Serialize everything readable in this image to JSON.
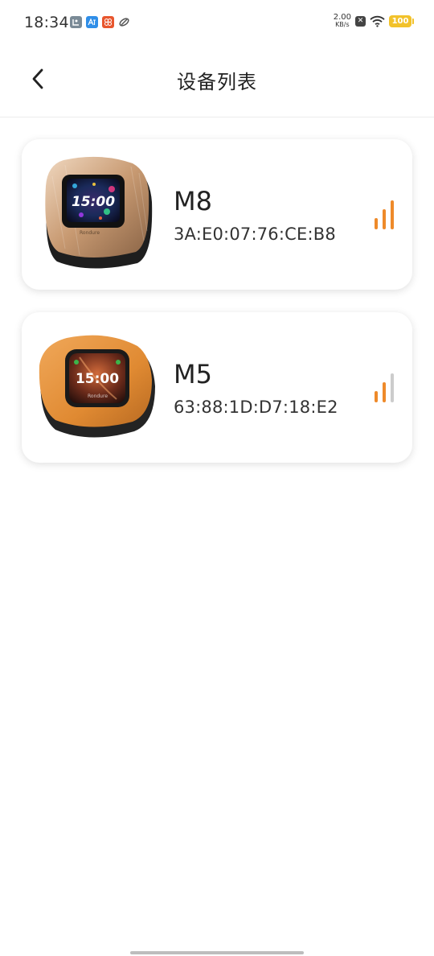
{
  "status_bar": {
    "time": "18:34",
    "net_speed_value": "2.00",
    "net_speed_unit": "KB/s",
    "battery": "100",
    "app_icons": [
      "notification-app-icon-1",
      "notification-app-icon-2",
      "notification-app-icon-3",
      "notification-app-icon-4"
    ],
    "colors": {
      "battery": "#f2c22b"
    }
  },
  "header": {
    "title": "设备列表",
    "back_icon": "chevron-left-icon"
  },
  "devices": [
    {
      "name": "M8",
      "mac": "3A:E0:07:76:CE:B8",
      "screen_time": "15:00",
      "signal_bars_active": 3,
      "signal_bars_total": 3,
      "body_color": "#c89a72"
    },
    {
      "name": "M5",
      "mac": "63:88:1D:D7:18:E2",
      "screen_time": "15:00",
      "signal_bars_active": 2,
      "signal_bars_total": 3,
      "body_color": "#e08a32"
    }
  ],
  "colors": {
    "accent": "#ee8a2a",
    "inactive_signal": "#cccccc"
  }
}
